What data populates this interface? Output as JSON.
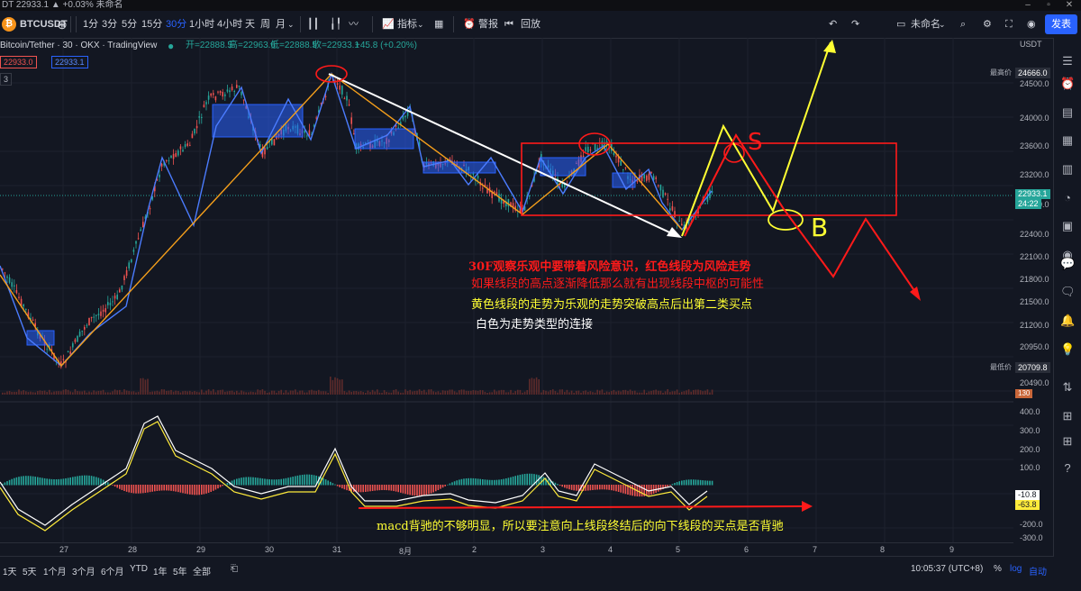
{
  "titlebar": {
    "text": "DT 22933.1 ▲ +0.03% 未命名"
  },
  "toolbar": {
    "symbol": "BTCUSDT",
    "intervals": [
      "1分",
      "3分",
      "5分",
      "15分",
      "30分",
      "1小时",
      "4小时",
      "天",
      "周",
      "月"
    ],
    "active_interval": "30分",
    "indicators_label": "指标",
    "alert_label": "警报",
    "replay_label": "回放",
    "layout_name": "未命名",
    "publish_label": "发表"
  },
  "legend": {
    "pair": "Bitcoin/Tether · 30 · OKX · TradingView",
    "open": "开=22888.5",
    "high": "高=22963.6",
    "low": "低=22888.5",
    "close": "收=22933.1",
    "change": "+45.8 (+0.20%)",
    "bid": "22933.0",
    "ask": "22933.1",
    "indicator_count": "3"
  },
  "price_axis": {
    "currency": "USDT",
    "ticks": [
      "24500.0",
      "24000.0",
      "23600.0",
      "23200.0",
      "22800.0",
      "22400.0",
      "22100.0",
      "21800.0",
      "21500.0",
      "21200.0",
      "20950.0",
      "20490.0"
    ],
    "highest_label": "最高价",
    "highest_value": "24666.0",
    "lowest_label": "最低价",
    "lowest_value": "20709.8",
    "current_price": "22933.1",
    "countdown": "24:22",
    "volume_tag": "130"
  },
  "macd_axis": {
    "ticks": [
      "400.0",
      "300.0",
      "200.0",
      "100.0",
      "-200.0",
      "-300.0"
    ],
    "value1": "-10.8",
    "value2": "-63.8"
  },
  "time_axis": {
    "labels": [
      "27",
      "28",
      "29",
      "30",
      "31",
      "8月",
      "2",
      "3",
      "4",
      "5",
      "6",
      "7",
      "8",
      "9"
    ]
  },
  "bottom": {
    "ranges": [
      "1天",
      "5天",
      "1个月",
      "3个月",
      "6个月",
      "YTD",
      "1年",
      "5年",
      "全部"
    ],
    "clock": "10:05:37 (UTC+8)",
    "percent": "%",
    "log": "log",
    "auto": "自动"
  },
  "annotations": {
    "red1": "30F观察乐观中要带着风险意识，红色线段为风险走势",
    "red2": "如果线段的高点逐渐降低那么就有出现线段中枢的可能性",
    "yellow1": "黄色线段的走势为乐观的走势突破高点后出第二类买点",
    "white1": "白色为走势类型的连接",
    "macd_note": "macd背驰的不够明显，所以要注意向上线段终结后的向下线段的买点是否背驰",
    "letter_s": "S",
    "letter_b": "B"
  },
  "colors": {
    "up": "#26a69a",
    "down": "#ef5350",
    "accent": "#2962ff",
    "annotation_red": "#ff1a1a",
    "annotation_yellow": "#ffff33"
  }
}
